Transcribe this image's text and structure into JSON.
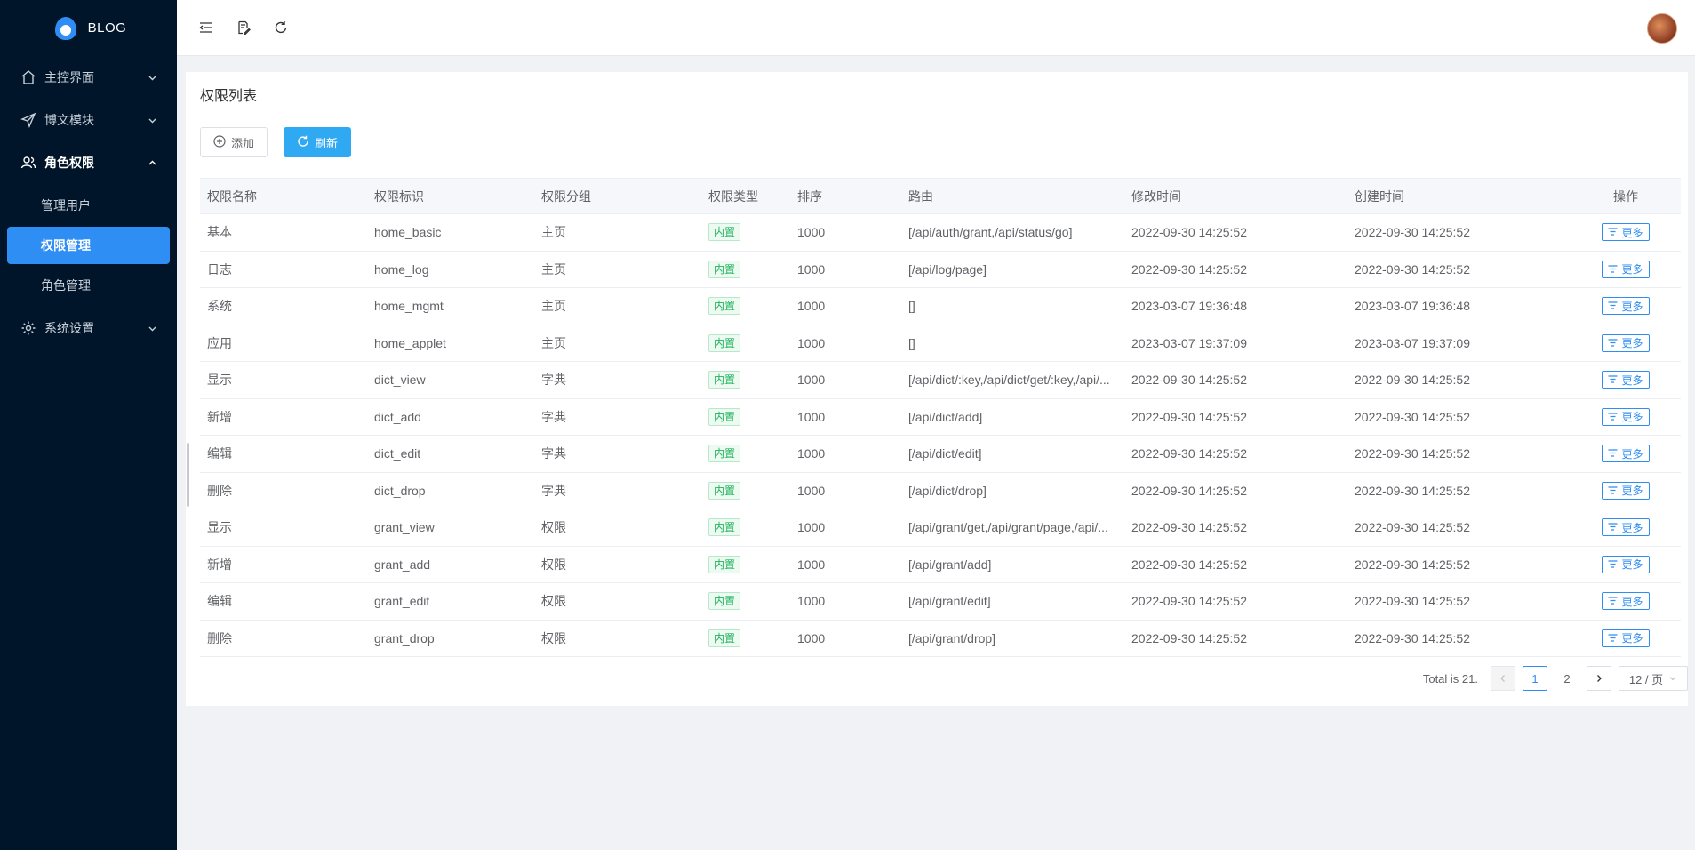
{
  "app": {
    "logo_text": "BLOG"
  },
  "sidebar": {
    "items": [
      {
        "label": "主控界面",
        "icon": "home-icon",
        "state": "collapsed"
      },
      {
        "label": "博文模块",
        "icon": "send-icon",
        "state": "collapsed"
      },
      {
        "label": "角色权限",
        "icon": "users-icon",
        "state": "expanded",
        "children": [
          {
            "label": "管理用户",
            "active": false
          },
          {
            "label": "权限管理",
            "active": true
          },
          {
            "label": "角色管理",
            "active": false
          }
        ]
      },
      {
        "label": "系统设置",
        "icon": "gear-icon",
        "state": "collapsed"
      }
    ]
  },
  "header": {
    "icons": [
      "menu-fold-icon",
      "edit-note-icon",
      "refresh-icon"
    ]
  },
  "card": {
    "title": "权限列表",
    "add_label": "添加",
    "refresh_label": "刷新"
  },
  "table": {
    "headers": [
      "权限名称",
      "权限标识",
      "权限分组",
      "权限类型",
      "排序",
      "路由",
      "修改时间",
      "创建时间",
      "操作"
    ],
    "rows": [
      [
        "基本",
        "home_basic",
        "主页",
        "内置",
        "1000",
        "[/api/auth/grant,/api/status/go]",
        "2022-09-30 14:25:52",
        "2022-09-30 14:25:52"
      ],
      [
        "日志",
        "home_log",
        "主页",
        "内置",
        "1000",
        "[/api/log/page]",
        "2022-09-30 14:25:52",
        "2022-09-30 14:25:52"
      ],
      [
        "系统",
        "home_mgmt",
        "主页",
        "内置",
        "1000",
        "[]",
        "2023-03-07 19:36:48",
        "2023-03-07 19:36:48"
      ],
      [
        "应用",
        "home_applet",
        "主页",
        "内置",
        "1000",
        "[]",
        "2023-03-07 19:37:09",
        "2023-03-07 19:37:09"
      ],
      [
        "显示",
        "dict_view",
        "字典",
        "内置",
        "1000",
        "[/api/dict/:key,/api/dict/get/:key,/api/...",
        "2022-09-30 14:25:52",
        "2022-09-30 14:25:52"
      ],
      [
        "新增",
        "dict_add",
        "字典",
        "内置",
        "1000",
        "[/api/dict/add]",
        "2022-09-30 14:25:52",
        "2022-09-30 14:25:52"
      ],
      [
        "编辑",
        "dict_edit",
        "字典",
        "内置",
        "1000",
        "[/api/dict/edit]",
        "2022-09-30 14:25:52",
        "2022-09-30 14:25:52"
      ],
      [
        "删除",
        "dict_drop",
        "字典",
        "内置",
        "1000",
        "[/api/dict/drop]",
        "2022-09-30 14:25:52",
        "2022-09-30 14:25:52"
      ],
      [
        "显示",
        "grant_view",
        "权限",
        "内置",
        "1000",
        "[/api/grant/get,/api/grant/page,/api/...",
        "2022-09-30 14:25:52",
        "2022-09-30 14:25:52"
      ],
      [
        "新增",
        "grant_add",
        "权限",
        "内置",
        "1000",
        "[/api/grant/add]",
        "2022-09-30 14:25:52",
        "2022-09-30 14:25:52"
      ],
      [
        "编辑",
        "grant_edit",
        "权限",
        "内置",
        "1000",
        "[/api/grant/edit]",
        "2022-09-30 14:25:52",
        "2022-09-30 14:25:52"
      ],
      [
        "删除",
        "grant_drop",
        "权限",
        "内置",
        "1000",
        "[/api/grant/drop]",
        "2022-09-30 14:25:52",
        "2022-09-30 14:25:52"
      ]
    ],
    "action_label": "更多"
  },
  "pagination": {
    "total_text": "Total is 21.",
    "pages": [
      "1",
      "2"
    ],
    "current": "1",
    "page_size": "12 / 页"
  },
  "colors": {
    "sidebar_bg": "#001529",
    "active": "#2f8ef4",
    "primary_button": "#2fa9f2",
    "tag_green": "#21b45c"
  }
}
